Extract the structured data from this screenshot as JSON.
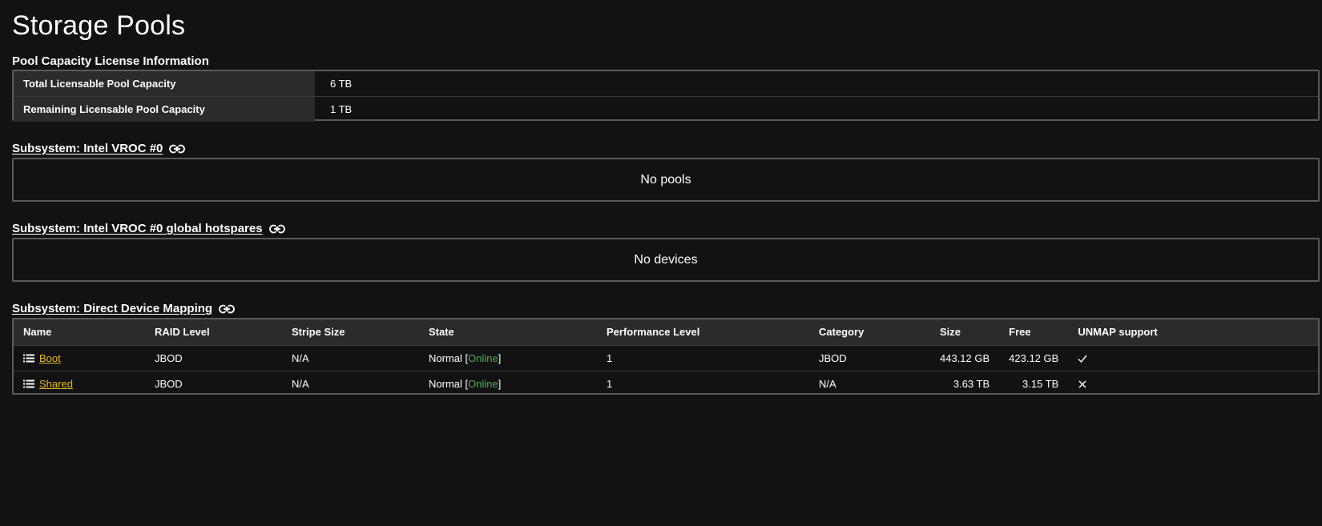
{
  "page": {
    "title": "Storage Pools"
  },
  "license": {
    "title": "Pool Capacity License Information",
    "rows": [
      {
        "label": "Total Licensable Pool Capacity",
        "value": "6 TB"
      },
      {
        "label": "Remaining Licensable Pool Capacity",
        "value": "1 TB"
      }
    ]
  },
  "subsystems": [
    {
      "title": "Subsystem: Intel VROC #0",
      "icon": "link-icon",
      "empty_text": "No pools"
    },
    {
      "title": "Subsystem: Intel VROC #0 global hotspares",
      "icon": "link-icon",
      "empty_text": "No devices"
    },
    {
      "title": "Subsystem: Direct Device Mapping",
      "icon": "link-icon"
    }
  ],
  "devices": {
    "columns": {
      "name": "Name",
      "raid": "RAID Level",
      "stripe": "Stripe Size",
      "state": "State",
      "perf": "Performance Level",
      "category": "Category",
      "size": "Size",
      "free": "Free",
      "unmap": "UNMAP support"
    },
    "rows": [
      {
        "name": "Boot",
        "raid": "JBOD",
        "stripe": "N/A",
        "state_prefix": "Normal [",
        "state_status": "Online",
        "state_suffix": "]",
        "perf": "1",
        "category": "JBOD",
        "size": "443.12 GB",
        "free": "423.12 GB",
        "unmap": "check-icon"
      },
      {
        "name": "Shared",
        "raid": "JBOD",
        "stripe": "N/A",
        "state_prefix": "Normal [",
        "state_status": "Online",
        "state_suffix": "]",
        "perf": "1",
        "category": "N/A",
        "size": "3.63 TB",
        "free": "3.15 TB",
        "unmap": "x-icon"
      }
    ]
  },
  "colors": {
    "background": "#121212",
    "link": "#e8b923",
    "online": "#4caf50",
    "border": "#5a5a5a"
  }
}
